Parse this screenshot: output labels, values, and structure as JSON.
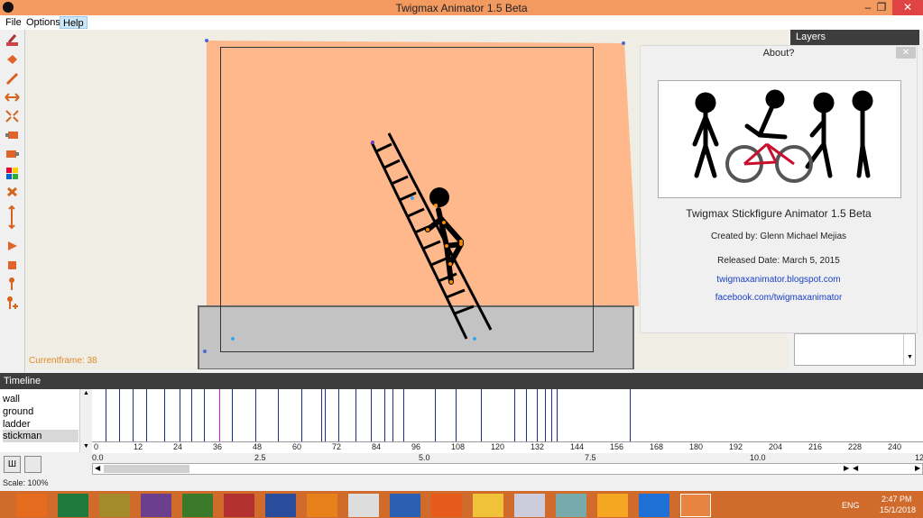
{
  "window": {
    "title": "Twigmax Animator 1.5 Beta",
    "minimize": "–",
    "restore": "❐",
    "close": "✕"
  },
  "menu": [
    "File",
    "Options",
    "Help"
  ],
  "canvas": {
    "currentframe": "Currentframe: 38"
  },
  "layers_panel": {
    "title": "Layers"
  },
  "about": {
    "title": "About?",
    "close": "✕",
    "app_name": "Twigmax Stickfigure Animator 1.5 Beta",
    "created_by": "Created by: Glenn Michael Mejias",
    "released": "Released Date: March 5, 2015",
    "blog": "twigmaxanimator.blogspot.com",
    "facebook": "facebook.com/twigmaxanimator"
  },
  "timeline": {
    "title": "Timeline",
    "layers": [
      "wall",
      "ground",
      "ladder",
      "stickman"
    ],
    "ruler_ticks": [
      "0",
      "12",
      "24",
      "36",
      "48",
      "60",
      "72",
      "84",
      "96",
      "108",
      "120",
      "132",
      "144",
      "156",
      "168",
      "180",
      "192",
      "204",
      "216",
      "228",
      "240"
    ],
    "seconds_ticks": [
      "0.0",
      "2.5",
      "5.0",
      "7.5",
      "10.0",
      "12"
    ],
    "scale": "Scale: 100%"
  },
  "tray": {
    "lang": "ENG",
    "time": "2:47 PM",
    "date": "15/1/2018"
  },
  "colors": {
    "accent": "#f39a61",
    "stage": "#ffb88b",
    "ground": "#c3c3c3",
    "keyframe": "#1e2a8c",
    "current_frame": "#d11fd6"
  }
}
